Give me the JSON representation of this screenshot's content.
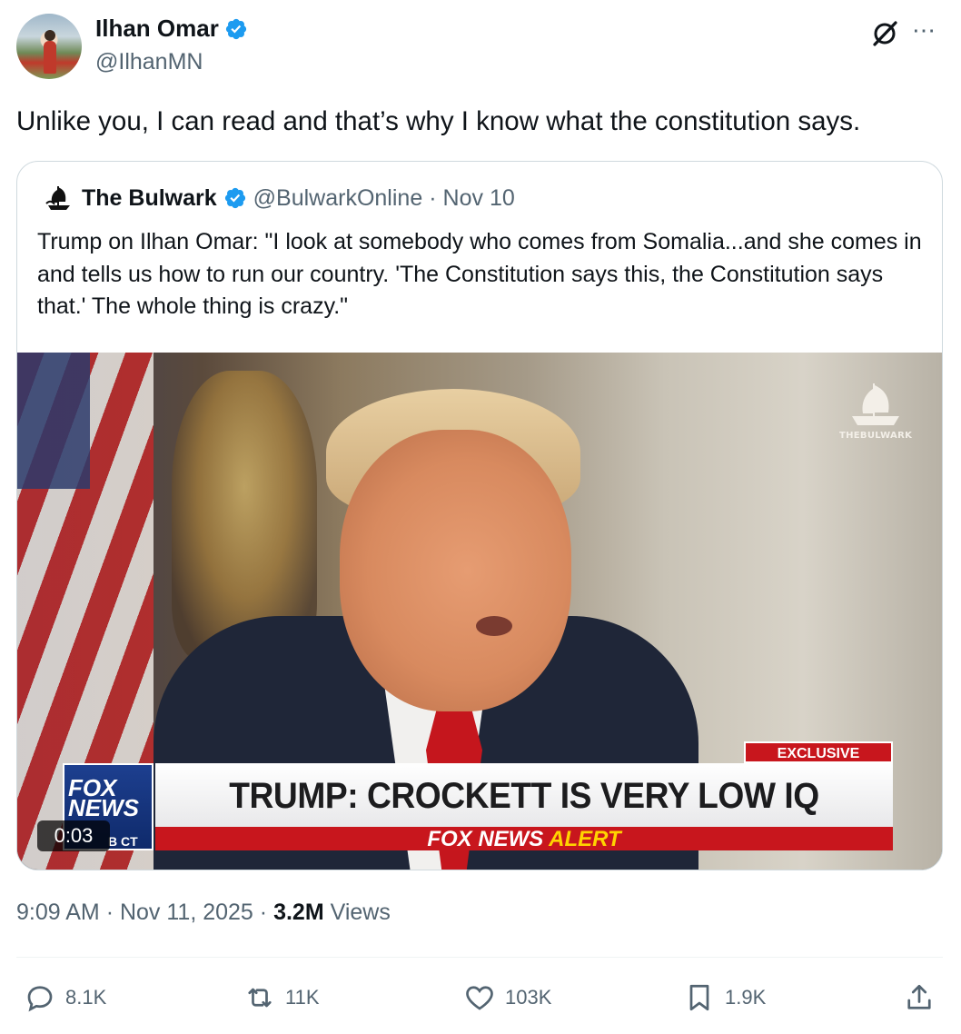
{
  "author": {
    "name": "Ilhan Omar",
    "handle": "@IlhanMN"
  },
  "tweet": {
    "text": "Unlike you, I can read and that’s why I know what the constitution says."
  },
  "quoted": {
    "name": "The Bulwark",
    "handle": "@BulwarkOnline",
    "separator": "·",
    "date": "Nov 10",
    "text": "Trump on Ilhan Omar: \"I look at somebody who comes from Somalia...and she comes in and tells us how to run our country. 'The Constitution says this, the Constitution says that.' The whole thing is crazy.\"",
    "video": {
      "watermark": "THEBULWARK",
      "exclusive": "EXCLUSIVE",
      "headline": "TRUMP: CROCKETT IS VERY LOW IQ",
      "alert_white": "FOX NEWS",
      "alert_yellow": "ALERT",
      "network_logo": "FOX NEWS",
      "logo_sub": "B CT",
      "timer": "0:03"
    }
  },
  "meta": {
    "time": "9:09 AM",
    "dot": "·",
    "date": "Nov 11, 2025",
    "views_count": "3.2M",
    "views_label": "Views"
  },
  "actions": {
    "replies": "8.1K",
    "reposts": "11K",
    "likes": "103K",
    "bookmarks": "1.9K"
  },
  "colors": {
    "verified": "#1d9bf0",
    "secondary_text": "#536471",
    "fox_red": "#c8161d"
  }
}
